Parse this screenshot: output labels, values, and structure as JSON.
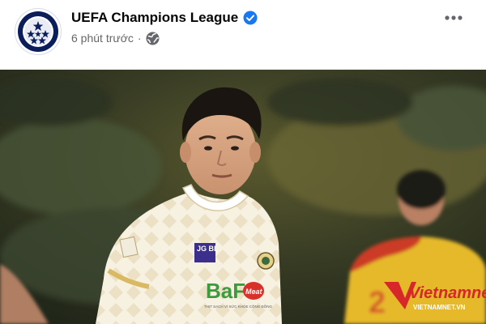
{
  "post": {
    "page_name": "UEFA Champions League",
    "timestamp": "6 phút trước",
    "separator": "·",
    "icons": {
      "avatar": "champions-league-starball-logo",
      "verified": "verified-badge-icon",
      "audience": "globe-icon",
      "more": "more-options-icon"
    },
    "colors": {
      "page_name": "#050505",
      "meta_text": "#65676b",
      "verified": "#1877f2",
      "logo_navy": "#0b1e5b"
    }
  },
  "photo": {
    "jersey_sponsor": "BaF",
    "jersey_sponsor_badge": "Meat",
    "jersey_sponsor_tagline": "THỊT SẠCH VÌ SỨC KHỎE CỘNG ĐỒNG",
    "jersey_brand": "JG BL",
    "watermark_brand": "Vietnamnet",
    "watermark_url": "VIETNAMNET.VN",
    "opponent_number": "2"
  }
}
